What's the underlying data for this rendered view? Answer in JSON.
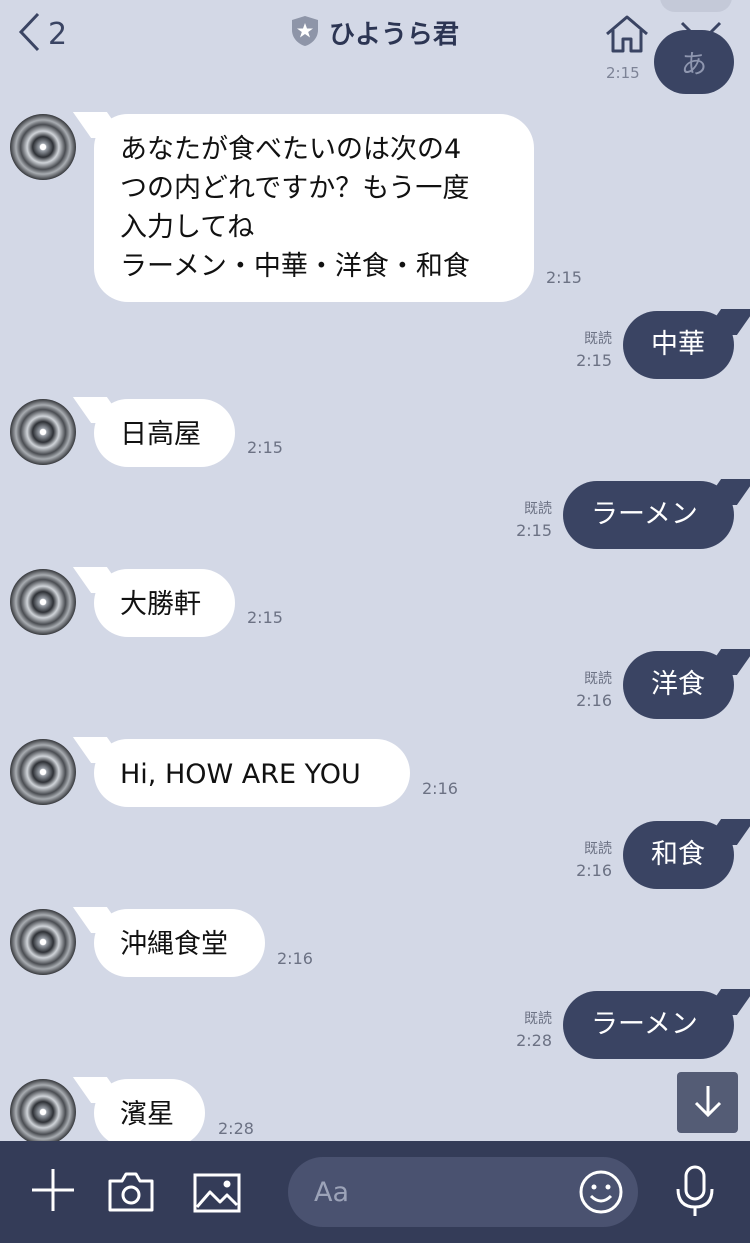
{
  "header": {
    "back_count": "2",
    "title": "ひようら君",
    "peek_char": "あ",
    "peek_time": "2:15"
  },
  "messages": [
    {
      "type": "in",
      "text": "あなたが食べたいのは次の4\nつの内どれですか？もう一度\n入力してね\nラーメン・中華・洋食・和食",
      "time": "2:15"
    },
    {
      "type": "out",
      "text": "中華",
      "read": "既読",
      "time": "2:15"
    },
    {
      "type": "in",
      "text": "日高屋",
      "time": "2:15"
    },
    {
      "type": "out",
      "text": "ラーメン",
      "read": "既読",
      "time": "2:15"
    },
    {
      "type": "in",
      "text": "大勝軒",
      "time": "2:15"
    },
    {
      "type": "out",
      "text": "洋食",
      "read": "既読",
      "time": "2:16"
    },
    {
      "type": "in",
      "text": "Hi, HOW ARE YOU",
      "time": "2:16"
    },
    {
      "type": "out",
      "text": "和食",
      "read": "既読",
      "time": "2:16"
    },
    {
      "type": "in",
      "text": "沖縄食堂",
      "time": "2:16"
    },
    {
      "type": "out",
      "text": "ラーメン",
      "read": "既読",
      "time": "2:28"
    },
    {
      "type": "in",
      "text": "濱星",
      "time": "2:28"
    }
  ],
  "input": {
    "placeholder": "Aa"
  },
  "icons": {
    "back": "chevron-left-icon",
    "verified": "shield-star-icon",
    "home": "home-icon",
    "menu": "chevron-down-icon",
    "scroll": "arrow-down-icon",
    "plus": "plus-icon",
    "camera": "camera-icon",
    "image": "image-icon",
    "emoji": "emoji-icon",
    "mic": "microphone-icon"
  },
  "colors": {
    "background": "#d3d8e6",
    "outgoing_bubble": "#3a4463",
    "incoming_bubble": "#ffffff",
    "bottom_bar": "#343c58"
  }
}
